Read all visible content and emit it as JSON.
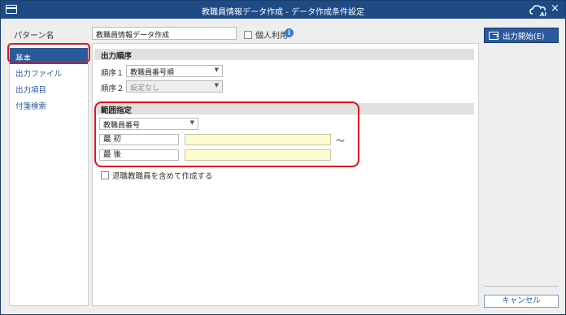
{
  "window": {
    "title": "教職員情報データ作成 - データ作成条件設定",
    "close_glyph": "×",
    "logo_text": "AI"
  },
  "pattern": {
    "label": "パターン名",
    "value": "教職員情報データ作成",
    "personal_label": "個人利用",
    "info_glyph": "i"
  },
  "sidebar": {
    "items": [
      {
        "label": "基本",
        "active": true
      },
      {
        "label": "出力ファイル",
        "active": false
      },
      {
        "label": "出力項目",
        "active": false
      },
      {
        "label": "付箋検索",
        "active": false
      }
    ]
  },
  "output_order": {
    "header": "出力順序",
    "rows": [
      {
        "label": "順序１",
        "value": "教職員番号順",
        "enabled": true
      },
      {
        "label": "順序２",
        "value": "設定なし",
        "enabled": false
      }
    ]
  },
  "range": {
    "header": "範囲指定",
    "field_select": "教職員番号",
    "first_label": "最 初",
    "last_label": "最 後",
    "first_value": "",
    "last_value": "",
    "tilde": "～"
  },
  "options": {
    "include_retired_label": "退職教職員を含めて作成する"
  },
  "actions": {
    "start_label": "出力開始(E)",
    "cancel_label": "キャンセル"
  },
  "colors": {
    "titlebar": "#1e4a86",
    "accent": "#2b5a9b",
    "highlight": "#e0141d",
    "input_yellow": "#fdfcd0"
  }
}
